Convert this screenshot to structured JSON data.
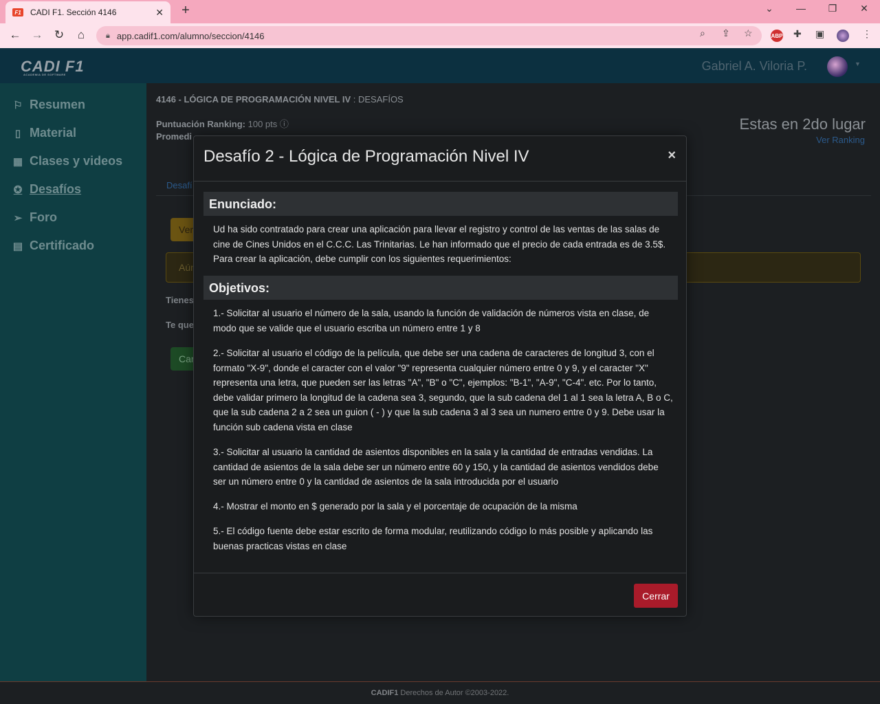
{
  "browser": {
    "tab_title": "CADI F1. Sección 4146",
    "favicon_text": "F1",
    "url": "app.cadif1.com/alumno/seccion/4146",
    "ext_abp": "ABP"
  },
  "header": {
    "logo": "CADI F1",
    "logo_sub": "ACADEMIA DE SOFTWARE",
    "user_name": "Gabriel A. Viloria P."
  },
  "sidebar": {
    "items": [
      {
        "label": "Resumen",
        "icon": "flag-icon"
      },
      {
        "label": "Material",
        "icon": "book-icon"
      },
      {
        "label": "Clases y videos",
        "icon": "calendar-icon"
      },
      {
        "label": "Desafíos",
        "icon": "compass-icon"
      },
      {
        "label": "Foro",
        "icon": "paper-plane-icon"
      },
      {
        "label": "Certificado",
        "icon": "certificate-icon"
      }
    ]
  },
  "main": {
    "course_code": "4146 - LÓGICA DE PROGRAMACIÓN NIVEL IV",
    "course_suffix": " : DESAFÍOS",
    "ranking_label": "Puntuación Ranking:",
    "ranking_value": "100 pts",
    "promedio_label": "Promedi",
    "rank_place": "Estas en 2do lugar",
    "rank_link": "Ver Ranking",
    "tab_label": "Desafí",
    "btn_yellow": "Ver",
    "alert_text": "Aún",
    "text1": "Tienes",
    "text2": "Te que",
    "btn_green": "Car"
  },
  "modal": {
    "title": "Desafío 2 - Lógica de Programación Nivel IV",
    "close": "×",
    "enunciado_h": "Enunciado:",
    "enunciado": "Ud ha sido contratado para crear una aplicación para llevar el registro y control de las ventas de las salas de cine de Cines Unidos en el C.C.C. Las Trinitarias. Le han informado que el precio de cada entrada es de 3.5$. Para crear la aplicación, debe cumplir con los siguientes requerimientos:",
    "objetivos_h": "Objetivos:",
    "objetivos": [
      "1.- Solicitar al usuario el número de la sala, usando la función de validación de números vista en clase, de modo que se valide que el usuario escriba un número entre 1 y 8",
      "2.- Solicitar al usuario el código de la película, que debe ser una cadena de caracteres de longitud 3, con el formato \"X-9\", donde el caracter con el valor \"9\" representa cualquier número entre 0 y 9, y el caracter \"X\" representa una letra, que pueden ser las letras \"A\", \"B\" o \"C\", ejemplos: \"B-1\", \"A-9\", \"C-4\". etc. Por lo tanto, debe validar primero la longitud de la cadena sea 3, segundo, que la sub cadena del 1 al 1 sea la letra A, B o C, que la sub cadena 2 a 2 sea un guion ( - ) y que la sub cadena 3 al 3 sea un numero entre 0 y 9. Debe usar la función sub cadena vista en clase",
      "3.- Solicitar al usuario la cantidad de asientos disponibles en la sala y la cantidad de entradas vendidas. La cantidad de asientos de la sala debe ser un número entre 60 y 150, y la cantidad de asientos vendidos debe ser un número entre 0 y la cantidad de asientos de la sala introducida por el usuario",
      "4.- Mostrar el monto en $ generado por la sala y el porcentaje de ocupación de la misma",
      "5.- El código fuente debe estar escrito de forma modular, reutilizando código lo más posible y aplicando las buenas practicas vistas en clase"
    ],
    "close_button": "Cerrar"
  },
  "footer": {
    "brand": "CADIF1",
    "text": " Derechos de Autor ©2003-2022."
  }
}
